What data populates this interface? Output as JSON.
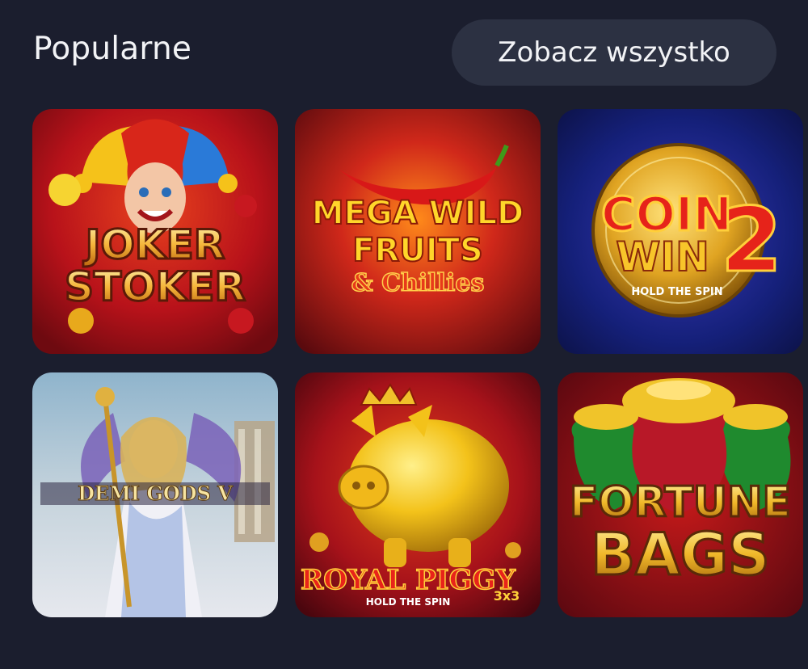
{
  "section": {
    "title": "Popularne",
    "see_all_label": "Zobacz wszystko"
  },
  "games": [
    {
      "name": "Joker Stoker",
      "logo_line1": "JOKER",
      "logo_line2": "STOKER"
    },
    {
      "name": "Mega Wild Fruits & Chillies",
      "logo_line1": "MEGA WILD",
      "logo_line2": "FRUITS",
      "logo_line3": "& Chillies"
    },
    {
      "name": "Coin Win 2 Hold The Spin",
      "logo_line1": "COIN",
      "logo_line2": "WIN",
      "logo_number": "2",
      "logo_sub": "HOLD THE SPIN"
    },
    {
      "name": "Demi Gods V",
      "logo_line1": "DEMI GODS V"
    },
    {
      "name": "Royal Piggy 3x3 Hold The Spin",
      "logo_line1": "ROYAL PIGGY",
      "logo_badge": "3x3",
      "logo_sub": "HOLD THE SPIN"
    },
    {
      "name": "Fortune Bags",
      "logo_line1": "FORTUNE",
      "logo_line2": "BAGS"
    }
  ],
  "colors": {
    "background": "#1b1e2e",
    "button_bg": "#2c3142",
    "text": "#f2f3f6"
  }
}
